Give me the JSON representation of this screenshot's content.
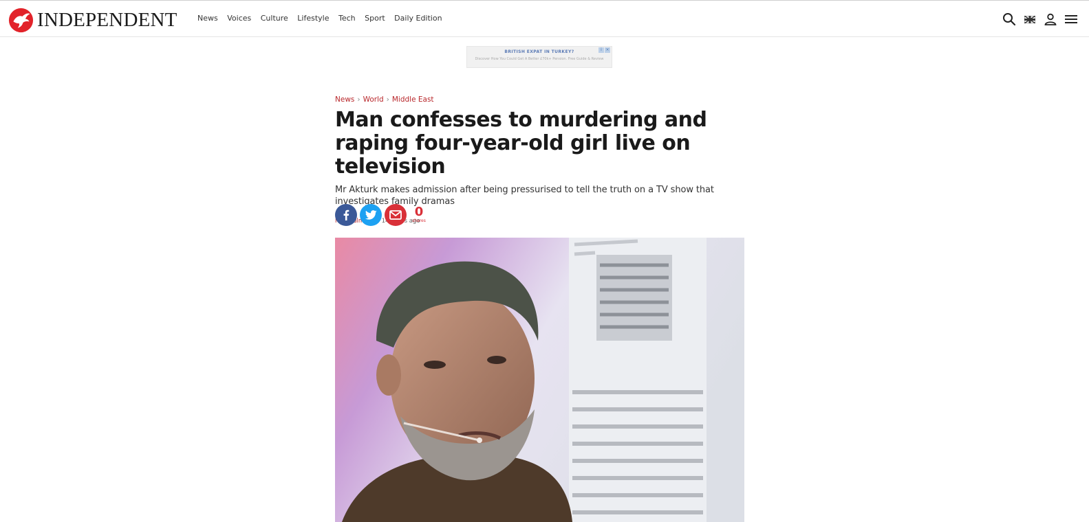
{
  "header": {
    "logo_text": "INDEPENDENT",
    "nav": [
      "News",
      "Voices",
      "Culture",
      "Lifestyle",
      "Tech",
      "Sport",
      "Daily Edition"
    ]
  },
  "ad": {
    "title": "BRITISH EXPAT IN TURKEY?",
    "subtitle": "Discover How You Could Get A Better £70k+ Pension. Free Guide & Review"
  },
  "article": {
    "breadcrumbs": [
      "News",
      "World",
      "Middle East"
    ],
    "headline": "Man confesses to murdering and raping four-year-old girl live on television",
    "standfirst": "Mr Akturk makes admission after being pressurised to tell the truth on a TV show that investigates family dramas",
    "author": "May Bulman",
    "time": "14 hours ago",
    "share_count": "0",
    "share_label": "shares"
  },
  "colors": {
    "brand_red": "#b8262a",
    "facebook": "#3b5998",
    "twitter": "#1da1f2",
    "email": "#d93038"
  },
  "icons": [
    "search-icon",
    "uk-flag-icon",
    "account-icon",
    "menu-icon",
    "facebook-icon",
    "twitter-icon",
    "email-icon"
  ]
}
